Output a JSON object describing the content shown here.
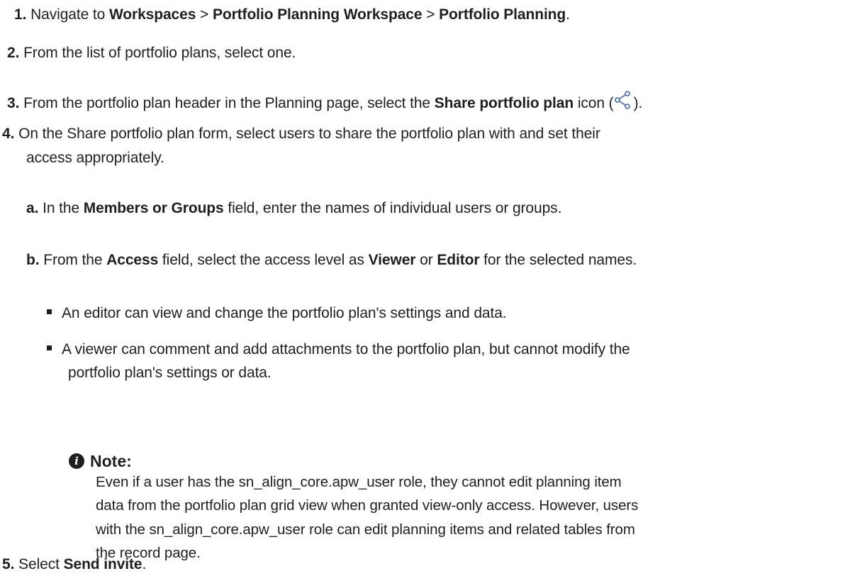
{
  "steps": {
    "s1": {
      "num": "1.",
      "t1": "Navigate to ",
      "b1": "Workspaces",
      "t2": " > ",
      "b2": "Portfolio Planning Workspace",
      "t3": " > ",
      "b3": "Portfolio Planning",
      "t4": "."
    },
    "s2": {
      "num": "2.",
      "text": "From the list of portfolio plans, select one."
    },
    "s3": {
      "num": "3.",
      "t1": "From the portfolio plan header in the Planning page, select the ",
      "b1": "Share portfolio plan",
      "t2": " icon (",
      "icon": "share-icon",
      "t3": ")."
    },
    "s4": {
      "num": "4.",
      "line1": "On the Share portfolio plan form, select users to share the portfolio plan with and set their",
      "line2": "access appropriately."
    },
    "s5": {
      "num": "5.",
      "t1": "Select ",
      "b1": "Send invite",
      "t2": "."
    }
  },
  "substeps": {
    "a": {
      "label": "a.",
      "t1": "In the ",
      "b1": "Members or Groups",
      "t2": " field, enter the names of individual users or groups."
    },
    "b": {
      "label": "b.",
      "t1": "From the ",
      "b1": "Access",
      "t2": " field, select the access level as ",
      "b2": "Viewer",
      "t3": " or ",
      "b3": "Editor",
      "t4": " for the selected names."
    }
  },
  "bullets": {
    "editor": "An editor can view and change the portfolio plan's settings and data.",
    "viewer_line1": "A viewer can comment and add attachments to the portfolio plan, but cannot modify the",
    "viewer_line2": "portfolio plan's settings or data."
  },
  "note": {
    "icon": "info-icon",
    "title": "Note:",
    "lines": [
      "Even if a user has the sn_align_core.apw_user role, they cannot edit planning item",
      "data from the portfolio plan grid view when granted view-only access. However, users",
      "with the sn_align_core.apw_user role can edit planning items and related tables from",
      "the record page."
    ]
  }
}
